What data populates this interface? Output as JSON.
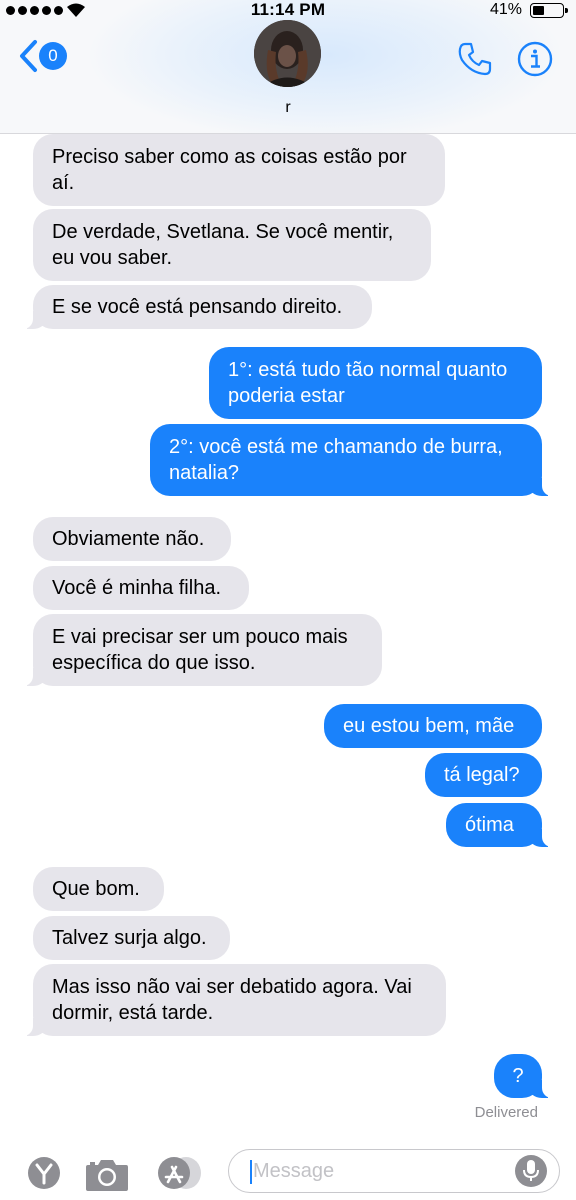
{
  "status_bar": {
    "time": "11:14 PM",
    "battery": "41%"
  },
  "header": {
    "back_badge": "0",
    "contact_name": "r"
  },
  "messages": [
    {
      "dir": "in",
      "text": "Preciso saber como as coisas estão por aí."
    },
    {
      "dir": "in",
      "text": "De verdade, Svetlana. Se você mentir, eu vou saber."
    },
    {
      "dir": "in",
      "text": "E se você está pensando direito."
    },
    {
      "dir": "out",
      "text": "1°: está tudo tão normal quanto poderia estar"
    },
    {
      "dir": "out",
      "text": "2°: você está me chamando de burra, natalia?"
    },
    {
      "dir": "in",
      "text": "Obviamente não."
    },
    {
      "dir": "in",
      "text": "Você é minha filha."
    },
    {
      "dir": "in",
      "text": "E vai precisar ser um pouco mais específica do que isso."
    },
    {
      "dir": "out",
      "text": "eu estou bem, mãe"
    },
    {
      "dir": "out",
      "text": "tá legal?"
    },
    {
      "dir": "out",
      "text": "ótima"
    },
    {
      "dir": "in",
      "text": "Que bom."
    },
    {
      "dir": "in",
      "text": "Talvez surja algo."
    },
    {
      "dir": "in",
      "text": "Mas isso não vai ser debatido agora. Vai dormir, está tarde."
    },
    {
      "dir": "out",
      "text": "?"
    }
  ],
  "delivery_status": "Delivered",
  "input_bar": {
    "placeholder": "Message",
    "value": ""
  },
  "icons": [
    "chevron-left-icon",
    "phone-icon",
    "info-icon",
    "money-icon",
    "camera-icon",
    "app-store-icon",
    "microphone-icon"
  ],
  "colors": {
    "accent": "#1a82fb",
    "incoming_bubble": "#e6e5eb",
    "outgoing_text": "#ffffff"
  }
}
